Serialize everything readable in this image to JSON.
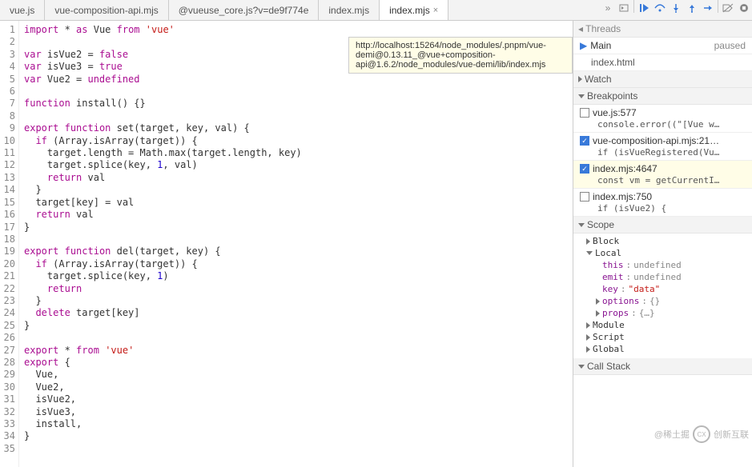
{
  "tabs": [
    {
      "label": "vue.js",
      "active": false
    },
    {
      "label": "vue-composition-api.mjs",
      "active": false
    },
    {
      "label": "@vueuse_core.js?v=de9f774e",
      "active": false
    },
    {
      "label": "index.mjs",
      "active": false
    },
    {
      "label": "index.mjs",
      "active": true
    }
  ],
  "tooltip": "http://localhost:15264/node_modules/.pnpm/vue-demi@0.13.11_@vue+composition-api@1.6.2/node_modules/vue-demi/lib/index.mjs",
  "code_lines": [
    {
      "n": 1,
      "html": "<span class='kw'>import</span> * <span class='kw'>as</span> Vue <span class='kw'>from</span> <span class='str'>'vue'</span>"
    },
    {
      "n": 2,
      "html": ""
    },
    {
      "n": 3,
      "html": "<span class='kw'>var</span> isVue2 = <span class='kw'>false</span>"
    },
    {
      "n": 4,
      "html": "<span class='kw'>var</span> isVue3 = <span class='kw'>true</span>"
    },
    {
      "n": 5,
      "html": "<span class='kw'>var</span> Vue2 = <span class='kw'>undefined</span>"
    },
    {
      "n": 6,
      "html": ""
    },
    {
      "n": 7,
      "html": "<span class='kw'>function</span> install() {}"
    },
    {
      "n": 8,
      "html": ""
    },
    {
      "n": 9,
      "html": "<span class='kw'>export</span> <span class='kw'>function</span> set(target, key, val) {"
    },
    {
      "n": 10,
      "html": "  <span class='kw'>if</span> (Array.isArray(target)) {"
    },
    {
      "n": 11,
      "html": "    target.length = Math.max(target.length, key)"
    },
    {
      "n": 12,
      "html": "    target.splice(key, <span class='num'>1</span>, val)"
    },
    {
      "n": 13,
      "html": "    <span class='kw'>return</span> val"
    },
    {
      "n": 14,
      "html": "  }"
    },
    {
      "n": 15,
      "html": "  target[key] = val"
    },
    {
      "n": 16,
      "html": "  <span class='kw'>return</span> val"
    },
    {
      "n": 17,
      "html": "}"
    },
    {
      "n": 18,
      "html": ""
    },
    {
      "n": 19,
      "html": "<span class='kw'>export</span> <span class='kw'>function</span> del(target, key) {"
    },
    {
      "n": 20,
      "html": "  <span class='kw'>if</span> (Array.isArray(target)) {"
    },
    {
      "n": 21,
      "html": "    target.splice(key, <span class='num'>1</span>)"
    },
    {
      "n": 22,
      "html": "    <span class='kw'>return</span>"
    },
    {
      "n": 23,
      "html": "  }"
    },
    {
      "n": 24,
      "html": "  <span class='kw'>delete</span> target[key]"
    },
    {
      "n": 25,
      "html": "}"
    },
    {
      "n": 26,
      "html": ""
    },
    {
      "n": 27,
      "html": "<span class='kw'>export</span> * <span class='kw'>from</span> <span class='str'>'vue'</span>"
    },
    {
      "n": 28,
      "html": "<span class='kw'>export</span> {"
    },
    {
      "n": 29,
      "html": "  Vue,"
    },
    {
      "n": 30,
      "html": "  Vue2,"
    },
    {
      "n": 31,
      "html": "  isVue2,"
    },
    {
      "n": 32,
      "html": "  isVue3,"
    },
    {
      "n": 33,
      "html": "  install,"
    },
    {
      "n": 34,
      "html": "}"
    },
    {
      "n": 35,
      "html": ""
    }
  ],
  "threads": {
    "header": "Threads",
    "main": "Main",
    "status": "paused",
    "file": "index.html"
  },
  "panels": {
    "watch": "Watch",
    "breakpoints": "Breakpoints",
    "scope": "Scope",
    "callstack": "Call Stack"
  },
  "breakpoints": [
    {
      "checked": false,
      "label": "vue.js:577",
      "preview": "console.error((\"[Vue w…",
      "active": false
    },
    {
      "checked": true,
      "label": "vue-composition-api.mjs:21…",
      "preview": "if (isVueRegistered(Vu…",
      "active": false
    },
    {
      "checked": true,
      "label": "index.mjs:4647",
      "preview": "const vm = getCurrentI…",
      "active": true
    },
    {
      "checked": false,
      "label": "index.mjs:750",
      "preview": "if (isVue2) {",
      "active": false
    }
  ],
  "scope": {
    "block": "Block",
    "local": "Local",
    "module": "Module",
    "script": "Script",
    "global": "Global",
    "vars": [
      {
        "name": "this",
        "value": "undefined",
        "type": "plain"
      },
      {
        "name": "emit",
        "value": "undefined",
        "type": "plain"
      },
      {
        "name": "key",
        "value": "\"data\"",
        "type": "string"
      },
      {
        "name": "options",
        "value": "{}",
        "type": "expand"
      },
      {
        "name": "props",
        "value": "{…}",
        "type": "expand"
      }
    ]
  },
  "watermark": {
    "text1": "@稀土掘",
    "text2": "创新互联"
  }
}
